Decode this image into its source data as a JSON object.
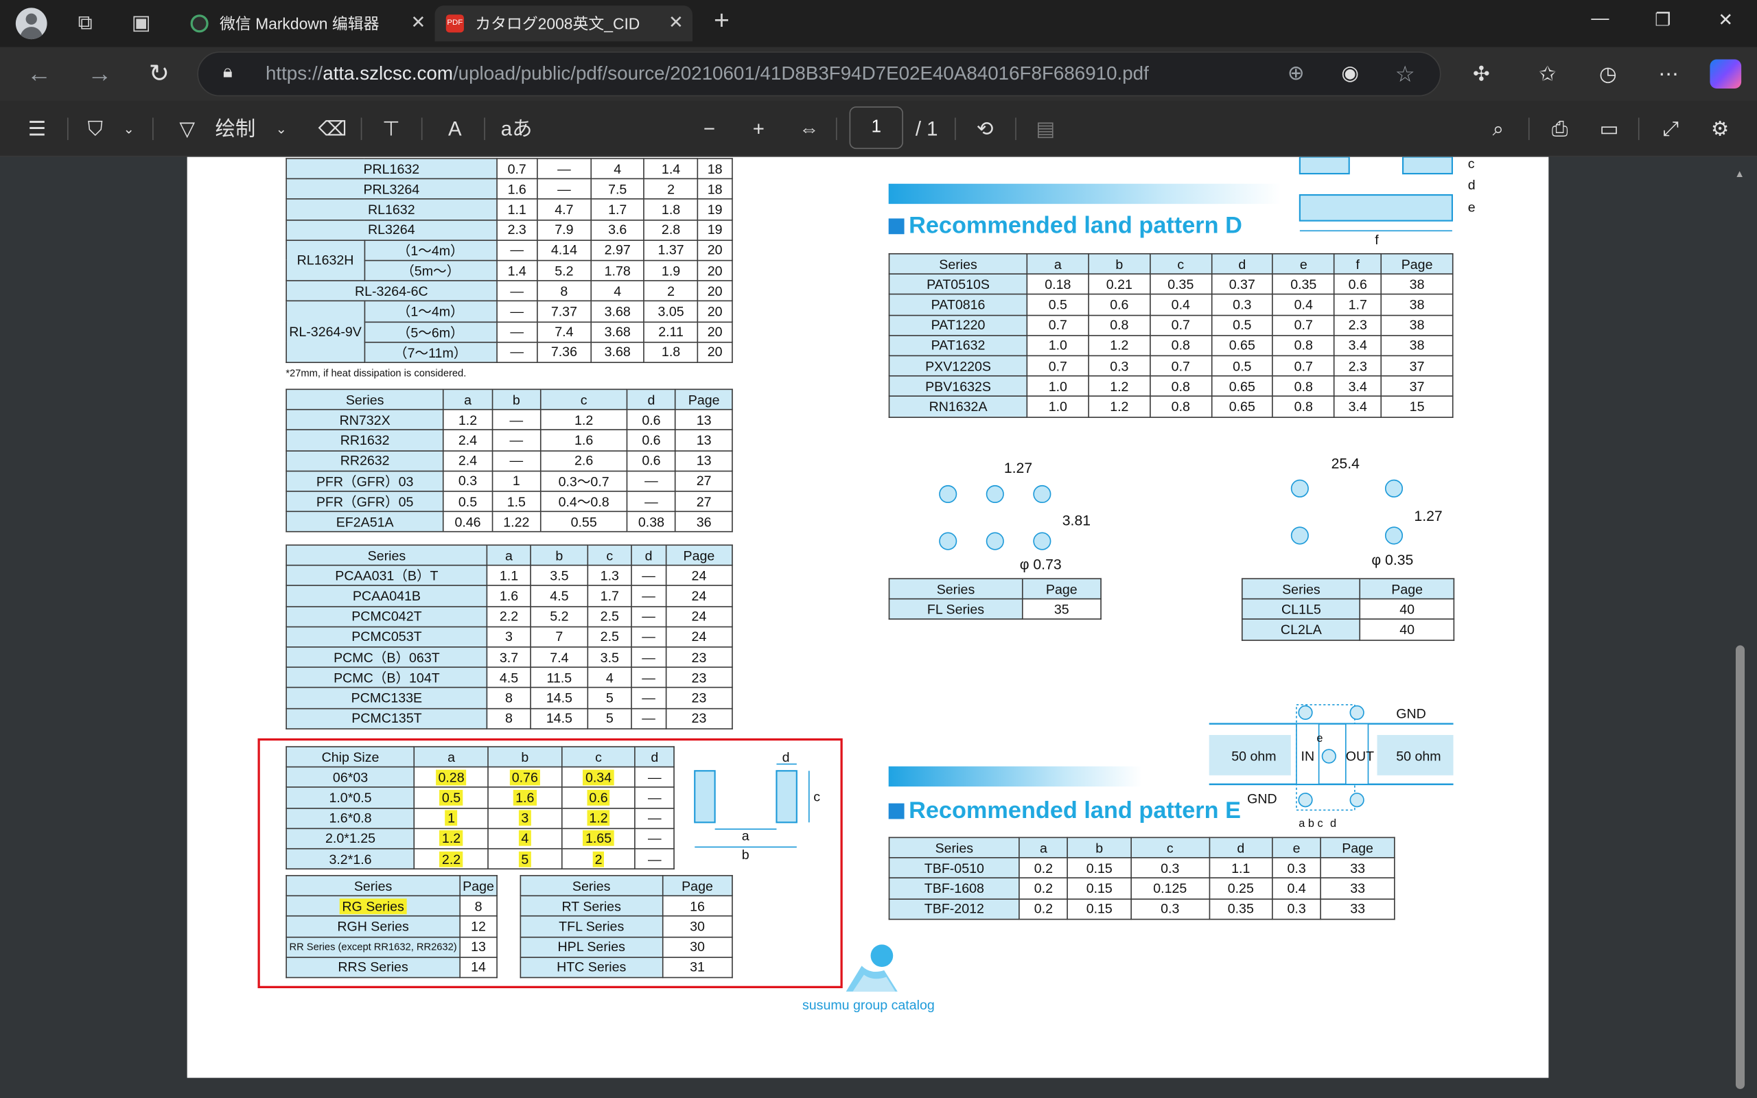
{
  "browser": {
    "tabs": [
      {
        "title": "微信 Markdown 编辑器",
        "active": false
      },
      {
        "title": "カタログ2008英文_CID",
        "active": true
      }
    ],
    "url_prefix": "https://",
    "url_host": "atta.szlcsc.com",
    "url_path": "/upload/public/pdf/source/20210601/41D8B3F94D7E02E40A84016F8F686910.pdf"
  },
  "pdf_toolbar": {
    "draw_label": "绘制",
    "text_size_label": "aあ",
    "page_current": "1",
    "page_total": "/ 1"
  },
  "doc": {
    "top_table": {
      "rows": [
        [
          "PRL1632",
          "",
          "0.7",
          "—",
          "4",
          "1.4",
          "18"
        ],
        [
          "PRL3264",
          "",
          "1.6",
          "—",
          "7.5",
          "2",
          "18"
        ],
        [
          "RL1632",
          "",
          "1.1",
          "4.7",
          "1.7",
          "1.8",
          "19"
        ],
        [
          "RL3264",
          "",
          "2.3",
          "7.9",
          "3.6",
          "2.8",
          "19"
        ],
        [
          "RL1632H",
          "（1～4m）",
          "—",
          "4.14",
          "2.97",
          "1.37",
          "20"
        ],
        [
          "",
          "（5m～）",
          "1.4",
          "5.2",
          "1.78",
          "1.9",
          "20"
        ],
        [
          "RL-3264-6C",
          "",
          "—",
          "8",
          "4",
          "2",
          "20"
        ],
        [
          "RL-3264-9V",
          "（1～4m）",
          "—",
          "7.37",
          "3.68",
          "3.05",
          "20"
        ],
        [
          "",
          "（5～6m）",
          "—",
          "7.4",
          "3.68",
          "2.11",
          "20"
        ],
        [
          "",
          "（7～11m）",
          "—",
          "7.36",
          "3.68",
          "1.8",
          "20"
        ]
      ],
      "note": "*27mm, if heat dissipation is considered."
    },
    "table_rn": {
      "header": [
        "Series",
        "a",
        "b",
        "c",
        "d",
        "Page"
      ],
      "rows": [
        [
          "RN732X",
          "1.2",
          "—",
          "1.2",
          "0.6",
          "13"
        ],
        [
          "RR1632",
          "2.4",
          "—",
          "1.6",
          "0.6",
          "13"
        ],
        [
          "RR2632",
          "2.4",
          "—",
          "2.6",
          "0.6",
          "13"
        ],
        [
          "PFR（GFR）03",
          "0.3",
          "1",
          "0.3～0.7",
          "—",
          "27"
        ],
        [
          "PFR（GFR）05",
          "0.5",
          "1.5",
          "0.4～0.8",
          "—",
          "27"
        ],
        [
          "EF2A51A",
          "0.46",
          "1.22",
          "0.55",
          "0.38",
          "36"
        ]
      ]
    },
    "table_pca": {
      "header": [
        "Series",
        "a",
        "b",
        "c",
        "d",
        "Page"
      ],
      "rows": [
        [
          "PCAA031（B）T",
          "1.1",
          "3.5",
          "1.3",
          "—",
          "24"
        ],
        [
          "PCAA041B",
          "1.6",
          "4.5",
          "1.7",
          "—",
          "24"
        ],
        [
          "PCMC042T",
          "2.2",
          "5.2",
          "2.5",
          "—",
          "24"
        ],
        [
          "PCMC053T",
          "3",
          "7",
          "2.5",
          "—",
          "24"
        ],
        [
          "PCMC（B）063T",
          "3.7",
          "7.4",
          "3.5",
          "—",
          "23"
        ],
        [
          "PCMC（B）104T",
          "4.5",
          "11.5",
          "4",
          "—",
          "23"
        ],
        [
          "PCMC133E",
          "8",
          "14.5",
          "5",
          "—",
          "23"
        ],
        [
          "PCMC135T",
          "8",
          "14.5",
          "5",
          "—",
          "23"
        ]
      ]
    },
    "table_chip": {
      "header": [
        "Chip Size",
        "a",
        "b",
        "c",
        "d"
      ],
      "rows": [
        [
          "06*03",
          "0.28",
          "0.76",
          "0.34",
          "—"
        ],
        [
          "1.0*0.5",
          "0.5",
          "1.6",
          "0.6",
          "—"
        ],
        [
          "1.6*0.8",
          "1",
          "3",
          "1.2",
          "—"
        ],
        [
          "2.0*1.25",
          "1.2",
          "4",
          "1.65",
          "—"
        ],
        [
          "3.2*1.6",
          "2.2",
          "5",
          "2",
          "—"
        ]
      ],
      "diagram_labels": {
        "a": "a",
        "b": "b",
        "c": "c",
        "d": "d"
      }
    },
    "table_rg": {
      "header": [
        "Series",
        "Page"
      ],
      "rows": [
        [
          "RG Series",
          "8"
        ],
        [
          "RGH Series",
          "12"
        ],
        [
          "RR Series (except RR1632, RR2632)",
          "13"
        ],
        [
          "RRS Series",
          "14"
        ]
      ]
    },
    "table_rt": {
      "header": [
        "Series",
        "Page"
      ],
      "rows": [
        [
          "RT Series",
          "16"
        ],
        [
          "TFL Series",
          "30"
        ],
        [
          "HPL Series",
          "30"
        ],
        [
          "HTC Series",
          "31"
        ]
      ]
    },
    "pattern_d": {
      "heading": "Recommended land pattern D",
      "diagram_labels": {
        "c": "c",
        "d": "d",
        "e": "e",
        "f": "f"
      },
      "header": [
        "Series",
        "a",
        "b",
        "c",
        "d",
        "e",
        "f",
        "Page"
      ],
      "rows": [
        [
          "PAT0510S",
          "0.18",
          "0.21",
          "0.35",
          "0.37",
          "0.35",
          "0.6",
          "38"
        ],
        [
          "PAT0816",
          "0.5",
          "0.6",
          "0.4",
          "0.3",
          "0.4",
          "1.7",
          "38"
        ],
        [
          "PAT1220",
          "0.7",
          "0.8",
          "0.7",
          "0.5",
          "0.7",
          "2.3",
          "38"
        ],
        [
          "PAT1632",
          "1.0",
          "1.2",
          "0.8",
          "0.65",
          "0.8",
          "3.4",
          "38"
        ],
        [
          "PXV1220S",
          "0.7",
          "0.3",
          "0.7",
          "0.5",
          "0.7",
          "2.3",
          "37"
        ],
        [
          "PBV1632S",
          "1.0",
          "1.2",
          "0.8",
          "0.65",
          "0.8",
          "3.4",
          "37"
        ],
        [
          "RN1632A",
          "1.0",
          "1.2",
          "0.8",
          "0.65",
          "0.8",
          "3.4",
          "15"
        ]
      ]
    },
    "fl": {
      "dim_pitch": "1.27",
      "dim_height": "3.81",
      "dim_dia": "φ 0.73",
      "header": [
        "Series",
        "Page"
      ],
      "rows": [
        [
          "FL Series",
          "35"
        ]
      ]
    },
    "cl": {
      "dim_pitch": "25.4",
      "dim_height": "1.27",
      "dim_dia": "φ 0.35",
      "header": [
        "Series",
        "Page"
      ],
      "rows": [
        [
          "CL1L5",
          "40"
        ],
        [
          "CL2LA",
          "40"
        ]
      ]
    },
    "pattern_e": {
      "heading": "Recommended land pattern E",
      "diagram": {
        "gnd_top": "GND",
        "gnd_left": "GND",
        "in_ohm": "50 ohm",
        "in": "IN",
        "out": "OUT",
        "out_ohm": "50 ohm",
        "e": "e",
        "abc": "a b c",
        "d": "d"
      },
      "header": [
        "Series",
        "a",
        "b",
        "c",
        "d",
        "e",
        "Page"
      ],
      "rows": [
        [
          "TBF-0510",
          "0.2",
          "0.15",
          "0.3",
          "1.1",
          "0.3",
          "33"
        ],
        [
          "TBF-1608",
          "0.2",
          "0.15",
          "0.125",
          "0.25",
          "0.4",
          "33"
        ],
        [
          "TBF-2012",
          "0.2",
          "0.15",
          "0.3",
          "0.35",
          "0.3",
          "33"
        ]
      ]
    },
    "footer": "susumu group catalog"
  },
  "colors": {
    "accent": "#20a8e0",
    "highlight": "#f6ef2b",
    "cell_bg": "#cdeaf6",
    "red_box": "#e0141c"
  }
}
